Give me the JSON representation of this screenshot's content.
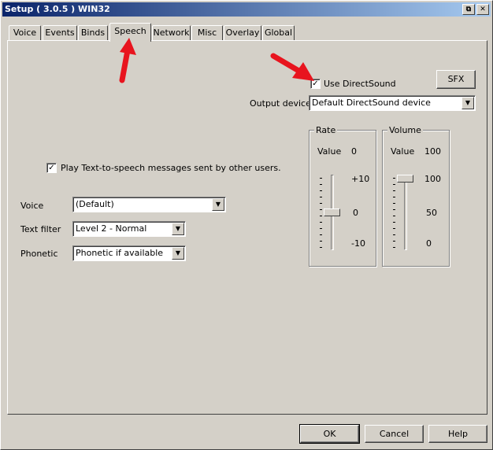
{
  "window": {
    "title": "Setup ( 3.0.5 ) WIN32",
    "restore_glyph": "⧉",
    "close_glyph": "✕"
  },
  "tabs": [
    {
      "label": "Voice"
    },
    {
      "label": "Events"
    },
    {
      "label": "Binds"
    },
    {
      "label": "Speech",
      "active": true
    },
    {
      "label": "Network"
    },
    {
      "label": "Misc"
    },
    {
      "label": "Overlay"
    },
    {
      "label": "Global"
    }
  ],
  "speech": {
    "use_directsound": {
      "label": "Use DirectSound",
      "checked": true
    },
    "sfx_button": "SFX",
    "output_device": {
      "label": "Output device",
      "value": "Default DirectSound device"
    },
    "play_tts": {
      "label": "Play Text-to-speech messages sent by other users.",
      "checked": true
    },
    "voice": {
      "label": "Voice",
      "value": "(Default)"
    },
    "text_filter": {
      "label": "Text filter",
      "value": "Level 2 - Normal"
    },
    "phonetic": {
      "label": "Phonetic",
      "value": "Phonetic if available"
    },
    "rate": {
      "title": "Rate",
      "value_label": "Value",
      "value": "0",
      "tick_top": "+10",
      "tick_mid": "0",
      "tick_bottom": "-10",
      "level": 0.5
    },
    "volume": {
      "title": "Volume",
      "value_label": "Value",
      "value": "100",
      "tick_top": "100",
      "tick_mid": "50",
      "tick_bottom": "0",
      "level": 1.0
    }
  },
  "footer": {
    "ok": "OK",
    "cancel": "Cancel",
    "help": "Help"
  },
  "check_glyph": "✓",
  "arrow_color": "#e8141e"
}
